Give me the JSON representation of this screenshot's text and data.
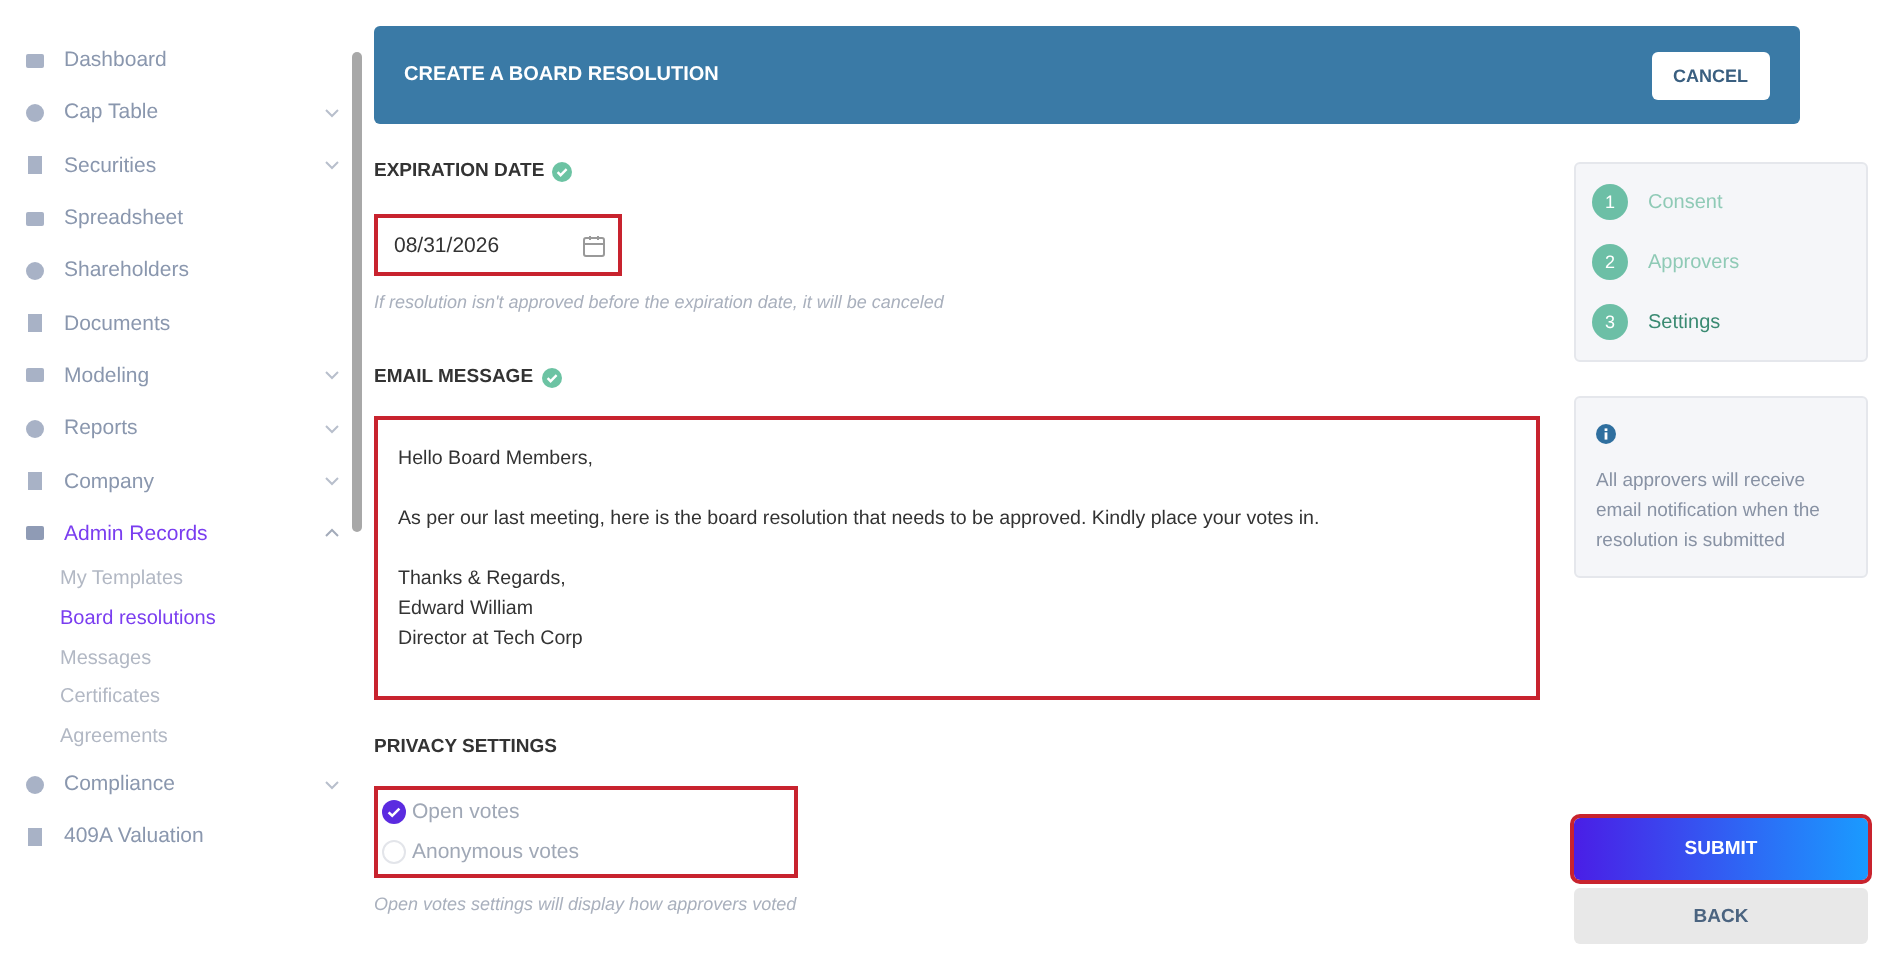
{
  "sidebar": {
    "items": [
      {
        "label": "Dashboard",
        "expandable": false,
        "selected": false
      },
      {
        "label": "Cap Table",
        "expandable": true,
        "expanded": false,
        "selected": false
      },
      {
        "label": "Securities",
        "expandable": true,
        "expanded": false,
        "selected": false
      },
      {
        "label": "Spreadsheet",
        "expandable": false,
        "selected": false
      },
      {
        "label": "Shareholders",
        "expandable": false,
        "selected": false
      },
      {
        "label": "Documents",
        "expandable": false,
        "selected": false
      },
      {
        "label": "Modeling",
        "expandable": true,
        "expanded": false,
        "selected": false
      },
      {
        "label": "Reports",
        "expandable": true,
        "expanded": false,
        "selected": false
      },
      {
        "label": "Company",
        "expandable": true,
        "expanded": false,
        "selected": false
      },
      {
        "label": "Admin Records",
        "expandable": true,
        "expanded": true,
        "selected": true,
        "children": [
          {
            "label": "My Templates",
            "selected": false
          },
          {
            "label": "Board resolutions",
            "selected": true
          },
          {
            "label": "Messages",
            "selected": false
          },
          {
            "label": "Certificates",
            "selected": false
          },
          {
            "label": "Agreements",
            "selected": false
          }
        ]
      },
      {
        "label": "Compliance",
        "expandable": true,
        "expanded": false,
        "selected": false
      },
      {
        "label": "409A Valuation",
        "expandable": false,
        "selected": false
      }
    ]
  },
  "header": {
    "title": "CREATE A BOARD RESOLUTION",
    "cancel_button": "CANCEL"
  },
  "expiration": {
    "label": "EXPIRATION DATE",
    "complete": true,
    "value": "08/31/2026",
    "highlighted": true,
    "hint": "If resolution isn't approved before the expiration date, it will be canceled"
  },
  "email": {
    "label": "EMAIL MESSAGE",
    "complete": true,
    "highlighted": true,
    "value": "Hello Board Members,\n\nAs per our last meeting, here is the board resolution that needs to be approved. Kindly place your votes in.\n\nThanks & Regards,\nEdward William\nDirector at Tech Corp"
  },
  "privacy": {
    "label": "PRIVACY SETTINGS",
    "highlighted": true,
    "options": [
      {
        "label": "Open votes",
        "selected": true
      },
      {
        "label": "Anonymous votes",
        "selected": false
      }
    ],
    "hint": "Open votes settings will display how approvers voted"
  },
  "steps": [
    {
      "number": "1",
      "label": "Consent",
      "selected": false
    },
    {
      "number": "2",
      "label": "Approvers",
      "selected": false
    },
    {
      "number": "3",
      "label": "Settings",
      "selected": true
    }
  ],
  "info": "All approvers will receive email notification when the resolution is submitted",
  "submit_button": {
    "label": "SUBMIT",
    "highlighted": true
  },
  "back_button": "BACK"
}
